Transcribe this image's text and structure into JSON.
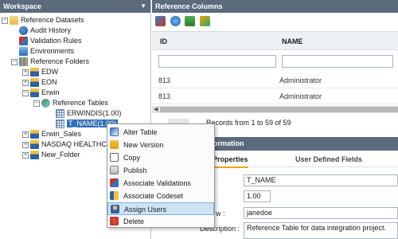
{
  "workspace": {
    "title": "Workspace",
    "tree": [
      {
        "label": "Reference Datasets",
        "icon": "folder-open-icon"
      },
      {
        "label": "Audit History",
        "icon": "audit-icon"
      },
      {
        "label": "Validation Rules",
        "icon": "validation-icon"
      },
      {
        "label": "Environments",
        "icon": "environment-icon"
      },
      {
        "label": "Reference Folders",
        "icon": "grid-folder-icon"
      },
      {
        "label": "EDW",
        "icon": "org-icon"
      },
      {
        "label": "EON",
        "icon": "org-icon"
      },
      {
        "label": "Erwin",
        "icon": "org-icon"
      },
      {
        "label": "Reference Tables",
        "icon": "reference-tables-icon"
      },
      {
        "label": "ERWINDIS(1.00)",
        "icon": "table-icon"
      },
      {
        "label": "T_NAME(1.00)",
        "icon": "table-icon"
      },
      {
        "label": "Erwin_Sales",
        "icon": "org-icon"
      },
      {
        "label": "NASDAQ HEALTHC",
        "icon": "org-icon"
      },
      {
        "label": "New_Folder",
        "icon": "org-icon"
      }
    ]
  },
  "columns_panel": {
    "title": "Reference Columns",
    "headers": [
      "ID",
      "NAME"
    ],
    "rows": [
      [
        "813",
        "Administrator"
      ],
      [
        "813",
        "Administrator"
      ]
    ],
    "pager_text": "Records from 1 to 59 of 59"
  },
  "info_panel": {
    "title": "Information",
    "tabs": [
      "Properties",
      "User Defined Fields"
    ],
    "fields": [
      {
        "label": "",
        "value": "T_NAME"
      },
      {
        "label": "",
        "value": "1.00"
      },
      {
        "label": "w :",
        "value": "janedoe"
      },
      {
        "label": "Description :",
        "value": "Reference Table for data integration project."
      }
    ]
  },
  "context_menu": [
    {
      "label": "Alter Table",
      "icon": "alter-table-icon"
    },
    {
      "label": "New Version",
      "icon": "new-version-icon"
    },
    {
      "label": "Copy",
      "icon": "copy-icon"
    },
    {
      "label": "Publish",
      "icon": "publish-icon"
    },
    {
      "label": "Associate Validations",
      "icon": "associate-validations-icon"
    },
    {
      "label": "Associate Codeset",
      "icon": "associate-codeset-icon"
    },
    {
      "label": "Assign Users",
      "icon": "assign-users-icon",
      "highlighted": true
    },
    {
      "label": "Delete",
      "icon": "delete-icon"
    }
  ],
  "colors": {
    "header_bg": "#5b6b7c",
    "selection": "#2f6db5",
    "tab_accent": "#f0a21b",
    "menu_highlight": "#cfe3f7"
  }
}
